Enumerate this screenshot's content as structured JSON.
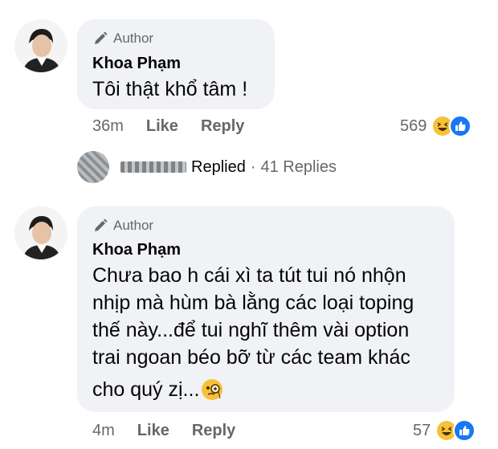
{
  "comments": [
    {
      "badge": "Author",
      "name": "Khoa Phạm",
      "text_lines": [
        "Tôi thật khổ tâm !"
      ],
      "time": "36m",
      "like": "Like",
      "reply": "Reply",
      "reaction_count": "569",
      "reactions": [
        "haha-emoji",
        "like-emoji"
      ]
    },
    {
      "badge": "Author",
      "name": "Khoa Phạm",
      "text_lines": [
        "Chưa bao h cái xì ta tút tui nó nhộn",
        "nhịp mà hùm bà lằng các loại toping",
        "thế này...để tui nghĩ thêm vài option",
        "trai ngoan béo bỡ từ các team khác",
        "cho quý zị..."
      ],
      "time": "4m",
      "like": "Like",
      "reply": "Reply",
      "reaction_count": "57",
      "reactions": [
        "haha-emoji",
        "like-emoji"
      ]
    }
  ],
  "replies_summary": {
    "label": "Replied",
    "separator": "·",
    "count_text": "41 Replies"
  },
  "colors": {
    "bubble": "#f0f2f5",
    "secondary_text": "#65676b",
    "like_blue": "#1877f2",
    "haha_yellow": "#f7c13a"
  },
  "icons": [
    "pen-icon",
    "monocle-emoji"
  ]
}
